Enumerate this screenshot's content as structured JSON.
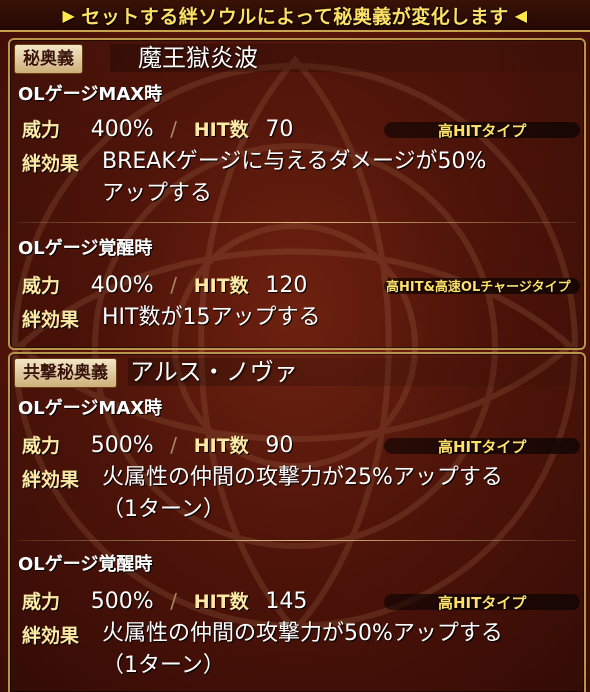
{
  "banner": {
    "left_arrow": "▶",
    "text": "セットする絆ソウルによって秘奥義が変化します",
    "right_arrow": "◀"
  },
  "skill1": {
    "badge": "秘奥義",
    "name": "魔王獄炎波",
    "max": {
      "heading": "OLゲージMAX時",
      "power_label": "威力",
      "power": "400%",
      "slash": "/",
      "hit_label": "HIT数",
      "hits": "70",
      "type": "高HITタイプ",
      "effect_label": "絆効果",
      "effect_line1": "BREAKゲージに与えるダメージが50%",
      "effect_line2": "アップする"
    },
    "awake": {
      "heading": "OLゲージ覚醒時",
      "power_label": "威力",
      "power": "400%",
      "slash": "/",
      "hit_label": "HIT数",
      "hits": "120",
      "type": "高HIT&高速OLチャージタイプ",
      "effect_label": "絆効果",
      "effect_line1": "HIT数が15アップする"
    }
  },
  "skill2": {
    "badge": "共撃秘奥義",
    "name": "アルス・ノヴァ",
    "max": {
      "heading": "OLゲージMAX時",
      "power_label": "威力",
      "power": "500%",
      "slash": "/",
      "hit_label": "HIT数",
      "hits": "90",
      "type": "高HITタイプ",
      "effect_label": "絆効果",
      "effect_line1": "火属性の仲間の攻撃力が25%アップする",
      "effect_line2": "（1ターン）"
    },
    "awake": {
      "heading": "OLゲージ覚醒時",
      "power_label": "威力",
      "power": "500%",
      "slash": "/",
      "hit_label": "HIT数",
      "hits": "145",
      "type": "高HITタイプ",
      "effect_label": "絆効果",
      "effect_line1": "火属性の仲間の攻撃力が50%アップする",
      "effect_line2": "（1ターン）"
    }
  },
  "colors": {
    "banner_text": "#ffe066",
    "label": "#ffe9a6",
    "type_text": "#ffdf6a",
    "frame": "#b8954a"
  }
}
